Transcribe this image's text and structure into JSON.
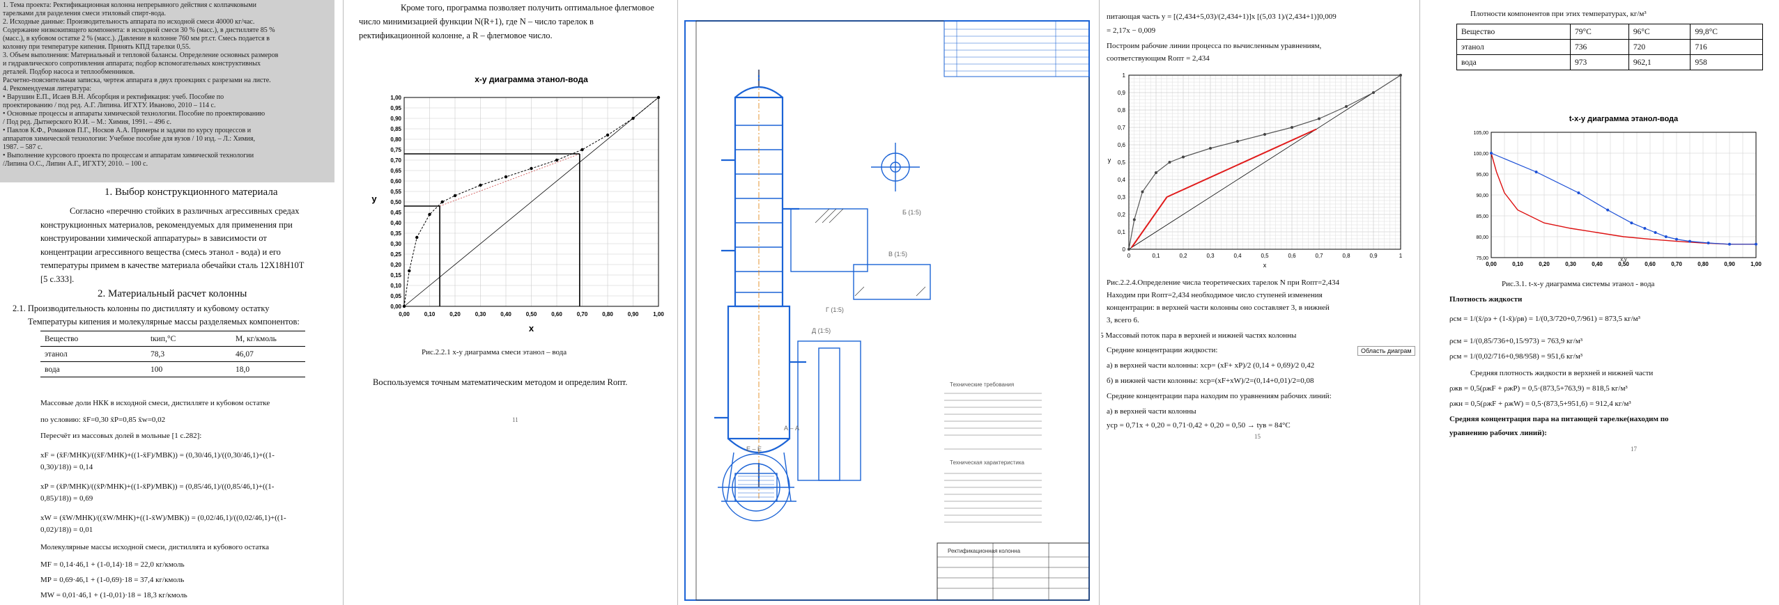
{
  "page1": {
    "scan_lines": [
      "1. Тема проекта: Ректификационная колонна непрерывного действия с колпачковыми",
      "тарелками для разделения смеси этиловый спирт-вода.",
      "2. Исходные данные: Производительность аппарата по исходной смеси 40000 кг/час.",
      "Содержание низкокипящего компонента: в исходной смеси 30 % (масс.), в дистилляте 85 %",
      "(масс.), в кубовом остатке 2 % (масс.). Давление в колонне 760 мм рт.ст. Смесь подается в",
      "колонну при температуре кипения. Принять КПД тарелки 0,55.",
      "3. Объем выполнения: Материальный и тепловой балансы. Определение основных размеров",
      "и гидравлического сопротивления аппарата; подбор вспомогательных конструктивных",
      "деталей. Подбор насоса и теплообменников.",
      "Расчетно-пояснительная записка, чертеж аппарата в двух проекциях с разрезами на листе.",
      "4. Рекомендуемая литература:",
      "• Варушин Е.П., Исаев В.Н. Абсорбция и ректификация: учеб. Пособие по",
      "проектированию / под ред. А.Г. Липина. ИГХТУ. Иваново, 2010 – 114 с.",
      "• Основные процессы и аппараты химической технологии. Пособие по проектированию",
      "/ Под ред. Дытнерского Ю.И. – М.: Химия, 1991. – 496 с.",
      "• Павлов К.Ф., Романков П.Г., Носков А.А. Примеры и задачи по курсу процессов и",
      "аппаратов химической технологии: Учебное пособие для вузов / 10 изд. – Л.: Химия,",
      "1987. – 587 с.",
      "• Выполнение курсового проекта по процессам и аппаратам химической технологии",
      "/Липина О.С., Липин А.Г., ИГХТУ, 2010. – 100 с."
    ],
    "heading1": "1. Выбор конструкционного материала",
    "para1": [
      "Согласно «перечню стойких в различных агрессивных средах",
      "конструкционных материалов, рекомендуемых для применения при",
      "конструировании химической аппаратуры» в зависимости от",
      "концентрации агрессивного вещества (смесь этанол - вода) и его",
      "температуры примем в качестве материала обечайки сталь 12Х18Н10Т",
      "[5 с.333]."
    ],
    "heading2": "2. Материальный расчет колонны",
    "sub21": "2.1. Производительность колонны по дистилляту и кубовому остатку",
    "temps_intro": "Температуры кипения и молекулярные массы разделяемых компонентов:",
    "table": {
      "headers": [
        "Вещество",
        "tкип,°C",
        "M, кг/кмоль"
      ],
      "rows": [
        [
          "этанол",
          "78,3",
          "46,07"
        ],
        [
          "вода",
          "100",
          "18,0"
        ]
      ]
    },
    "frac_intro": "Массовые доли НКК в исходной смеси, дистилляте и кубовом  остатке",
    "frac_cond": "по условию:   x̄F=0,30    x̄P=0,85    x̄w=0,02",
    "recalc": "Пересчёт из массовых долей в мольные [1 с.282]:",
    "xf": "xF = (x̄F/MНК)/((x̄F/MНК)+((1-x̄F)/MВК)) = (0,30/46,1)/((0,30/46,1)+((1-",
    "xf2": "0,30)/18))  = 0,14",
    "xp": "xP = (x̄P/MНК)/((x̄P/MНК)+((1-x̄P)/MВК)) = (0,85/46,1)/((0,85/46,1)+((1-",
    "xp2": "0,85)/18)) = 0,69",
    "xw": "xW = (x̄W/MНК)/((x̄W/MНК)+((1-x̄W)/MВК)) = (0,02/46,1)/((0,02/46,1)+((1-",
    "xw2": "0,02)/18)) = 0,01",
    "mm_title": "Молекулярные массы исходной смеси, дистиллята и кубового остатка",
    "mf": "MF = 0,14·46,1 + (1-0,14)·18 = 22,0 кг/кмоль",
    "mp": "MP = 0,69·46,1 + (1-0,69)·18 = 37,4 кг/кмоль",
    "mw": "MW = 0,01·46,1 + (1-0,01)·18 = 18,3 кг/кмоль"
  },
  "page2": {
    "intro": [
      "Кроме того, программа позволяет получить оптимальное флегмовое",
      "число минимизацией функции N(R+1), где N – число тарелок в",
      "ректификационной колонне, а R – флегмовое число."
    ],
    "caption": "Рис.2.2.1 x-y диаграмма смеси этанол – вода",
    "bottom": "Воспользуемся точным математическим методом и определим Rопт.",
    "page_no": "11"
  },
  "xy_chart": {
    "type": "line",
    "title": "x-y диаграмма этанол-вода",
    "xlabel": "x",
    "ylabel": "y",
    "xlim": [
      0,
      1
    ],
    "ylim": [
      0,
      1
    ],
    "xticks": [
      "0,00",
      "0,10",
      "0,20",
      "0,30",
      "0,40",
      "0,50",
      "0,60",
      "0,70",
      "0,80",
      "0,90",
      "1,00"
    ],
    "yticks": [
      "0,00",
      "0,05",
      "0,10",
      "0,15",
      "0,20",
      "0,25",
      "0,30",
      "0,35",
      "0,40",
      "0,45",
      "0,50",
      "0,55",
      "0,60",
      "0,65",
      "0,70",
      "0,75",
      "0,80",
      "0,85",
      "0,90",
      "0,95",
      "1,00"
    ],
    "equilibrium_x": [
      0,
      0.02,
      0.05,
      0.1,
      0.15,
      0.2,
      0.3,
      0.4,
      0.5,
      0.6,
      0.7,
      0.8,
      0.9,
      1.0
    ],
    "equilibrium_y": [
      0,
      0.17,
      0.33,
      0.44,
      0.5,
      0.53,
      0.58,
      0.62,
      0.66,
      0.7,
      0.75,
      0.82,
      0.9,
      1.0
    ],
    "xp": 0.69,
    "yp": 0.73,
    "xf": 0.14,
    "yf": 0.48
  },
  "page3": {
    "title_block": "Ректификационная колонна",
    "tech_title": "Технические требования",
    "tech_title2": "Техническая характеристика",
    "views": [
      "Б (1:5)",
      "В (1:5)",
      "Г (1:5)",
      "Д (1:5)",
      "А – А",
      "Е – Е"
    ]
  },
  "page4": {
    "line1": "питающая часть y = [(2,434+5,03)/(2,434+1)]x   [(5,03    1)/(2,434+1)]0,009",
    "line2": "= 2,17x − 0,009",
    "para": "Построим рабочие линии процесса по вычисленным уравнениям,",
    "para2": "соответствующим Rопт = 2,434",
    "caption": "Рис.2.2.4.Определение числа теоретических тарелок N при Rопт=2,434",
    "c2": "Находим при Rопт=2,434 необходимое число ступеней изменения",
    "c3": "концентрации: в верхней части колонны оно составляет 3, в нижней",
    "c4": "3, всего 6.",
    "sec": "2.5 Массовый поток пара в верхней и нижней частях колонны",
    "avg": "Средние концентрации жидкости:",
    "tooltip": "Область диаграм",
    "a": "а) в верхней части колонны: xср=  (xF+ xP)/2  (0,14 + 0,69)/2   0,42",
    "b": "б) в нижней части колонны: xср=(xF+xW)/2=(0,14+0,01)/2=0,08",
    "avg2": "Средние концентрации пара находим по уравнениям рабочих линий:",
    "a2": "а) в  верхней части колонны",
    "y": "yср = 0,71x + 0,20 = 0,71·0,42 + 0,20 = 0,50 → tyв = 84°C",
    "page_no": "15"
  },
  "mc_chart": {
    "type": "line",
    "xlabel": "x",
    "ylabel": "y",
    "xlim": [
      0,
      1
    ],
    "ylim": [
      0,
      1
    ],
    "xticks": [
      "0",
      "0,1",
      "0,2",
      "0,3",
      "0,4",
      "0,5",
      "0,6",
      "0,7",
      "0,8",
      "0,9",
      "1"
    ],
    "yticks": [
      "0",
      "0,1",
      "0,2",
      "0,3",
      "0,4",
      "0,5",
      "0,6",
      "0,7",
      "0,8",
      "0,9",
      "1"
    ],
    "equilibrium_x": [
      0,
      0.02,
      0.05,
      0.1,
      0.15,
      0.2,
      0.3,
      0.4,
      0.5,
      0.6,
      0.7,
      0.8,
      0.9,
      1.0
    ],
    "equilibrium_y": [
      0,
      0.17,
      0.33,
      0.44,
      0.5,
      0.53,
      0.58,
      0.62,
      0.66,
      0.7,
      0.75,
      0.82,
      0.9,
      1.0
    ],
    "operating_x": [
      0.01,
      0.14,
      0.69
    ],
    "operating_y": [
      0.01,
      0.3,
      0.69
    ]
  },
  "page5": {
    "density_title": "Плотности компонентов при этих температурах, кг/м³",
    "dtable": {
      "headers": [
        "Вещество",
        "79°С",
        "96°С",
        "99,8°С"
      ],
      "rows": [
        [
          "этанол",
          "736",
          "720",
          "716"
        ],
        [
          "вода",
          "973",
          "962,1",
          "958"
        ]
      ]
    },
    "caption": "Рис.3.1. t-x-y диаграмма системы этанол - вода",
    "dens": "Плотность жидкости",
    "r1": "ρсм = 1/(x̄/ρэ + (1-x̄)/ρв) = 1/(0,3/720+0,7/961) = 873,5 кг/м³",
    "r2": "ρсм = 1/(0,85/736+0,15/973) = 763,9 кг/м³",
    "r3": "ρсм = 1/(0,02/716+0,98/958) = 951,6 кг/м³",
    "avgd": "Средняя плотность жидкости в верхней и нижней части",
    "rv": "ρжв = 0,5(ρжF + ρжP) = 0,5·(873,5+763,9) = 818,5 кг/м³",
    "rn": "ρжн = 0,5(ρжF + ρжW) = 0,5·(873,5+951,6) = 912,4 кг/м³",
    "last": "Средняя концентрация пара на питающей тарелке(находим по",
    "last2": "уравнению рабочих линий):",
    "page_no": "17"
  },
  "txy_chart": {
    "type": "line",
    "title": "t-x-y диаграмма этанол-вода",
    "xlabel": "x,y",
    "xlim": [
      0,
      1
    ],
    "ylim": [
      75,
      105
    ],
    "xticks": [
      "0,00",
      "0,10",
      "0,20",
      "0,30",
      "0,40",
      "0,50",
      "0,60",
      "0,70",
      "0,80",
      "0,90",
      "1,00"
    ],
    "yticks": [
      "75,00",
      "80,00",
      "85,00",
      "90,00",
      "95,00",
      "100,00",
      "105,00"
    ],
    "liquid_x": [
      0,
      0.02,
      0.05,
      0.1,
      0.2,
      0.3,
      0.4,
      0.5,
      0.6,
      0.7,
      0.8,
      0.9,
      1.0
    ],
    "liquid_t": [
      100,
      95.5,
      90.5,
      86.4,
      83.3,
      82.0,
      81.0,
      80.0,
      79.4,
      78.9,
      78.5,
      78.2,
      78.2
    ],
    "vapor_x": [
      0,
      0.17,
      0.33,
      0.44,
      0.53,
      0.58,
      0.62,
      0.66,
      0.7,
      0.75,
      0.82,
      0.9,
      1.0
    ],
    "vapor_t": [
      100,
      95.5,
      90.5,
      86.4,
      83.3,
      82.0,
      81.0,
      80.0,
      79.4,
      78.9,
      78.5,
      78.2,
      78.2
    ]
  }
}
